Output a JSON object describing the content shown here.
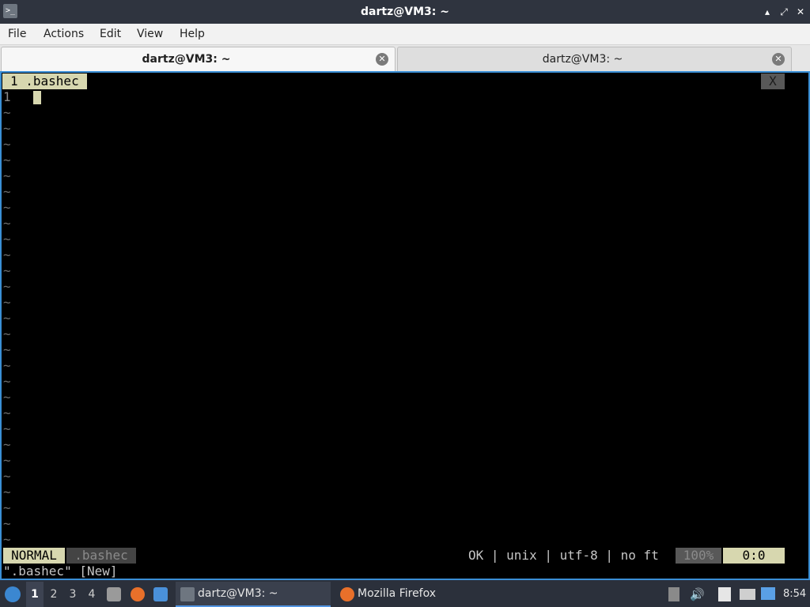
{
  "window": {
    "title": "dartz@VM3: ~",
    "icon": "terminal-icon",
    "controls": {
      "minimize": "▴",
      "maximize": "⤢",
      "close": "✕"
    }
  },
  "menu": {
    "file": "File",
    "actions": "Actions",
    "edit": "Edit",
    "view": "View",
    "help": "Help"
  },
  "tabs": [
    {
      "label": "dartz@VM3: ~",
      "active": true
    },
    {
      "label": "dartz@VM3: ~",
      "active": false
    }
  ],
  "vim": {
    "tabline": {
      "active_tab": "1 .bashec",
      "close": "X"
    },
    "first_line_number": "1",
    "tilde": "~",
    "status": {
      "mode": "NORMAL",
      "filename": ".bashec",
      "info": "OK | unix | utf-8 | no ft",
      "percent": "100%",
      "position": "0:0"
    },
    "cmdline": "\".bashec\" [New]"
  },
  "taskbar": {
    "workspaces": [
      "1",
      "2",
      "3",
      "4"
    ],
    "terminal_task": "dartz@VM3: ~",
    "firefox_task": "Mozilla Firefox",
    "clock": "8:54"
  },
  "colors": {
    "terminal_bg": "#000000",
    "vim_accent": "#d7d7af",
    "focus_border": "#3a8fd6",
    "panel_bg": "#2b303b"
  }
}
